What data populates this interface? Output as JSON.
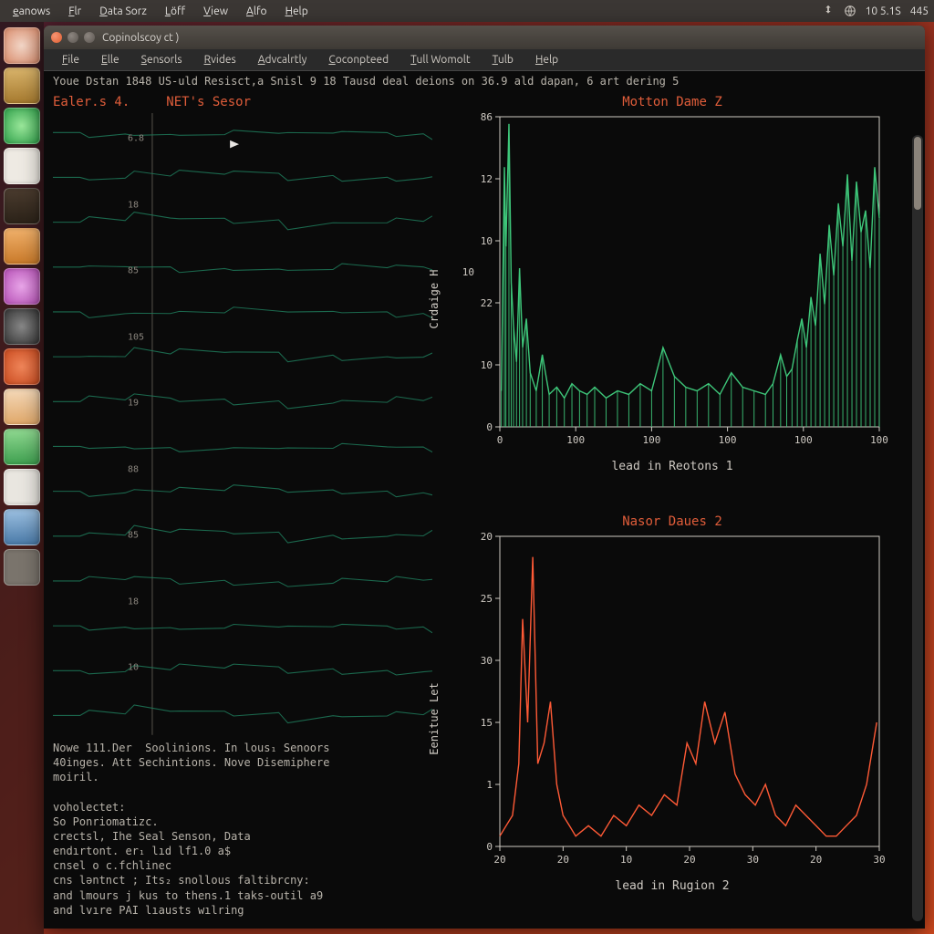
{
  "os_menubar": {
    "items": [
      "eanows",
      "Flr",
      "Data Sorz",
      "Löff",
      "View",
      "Alfo",
      "Help"
    ],
    "tray": {
      "time": "10 5.1S",
      "extra": "445"
    }
  },
  "launcher": {
    "apps": [
      "app-1",
      "app-2",
      "app-3",
      "app-4",
      "app-5",
      "app-6",
      "app-7",
      "app-8",
      "app-9",
      "app-10",
      "app-11",
      "app-12",
      "app-13",
      "app-14"
    ]
  },
  "window": {
    "title": "Copinolscoy ct )",
    "menubar": [
      "File",
      "Elle",
      "Sensorls",
      "Rvides",
      "Advcalrtly",
      "Coconpteed",
      "Tull Womolt",
      "Tulb",
      "Help"
    ],
    "status_line": "Youe Dstan 1848           US-uld Resisct,a  Snisl 9 18  Tausd deal deions on 36.9 ald dapan, 6 art dering 5"
  },
  "left_panel": {
    "title_a": "Ealer.s 4.",
    "title_b": "NET's Sesor",
    "yticks": [
      "6.8",
      "18",
      "85",
      "105",
      "19",
      "88",
      "85",
      "18",
      "10"
    ],
    "terminal_lines": [
      "Nowe 111.Der  Soolinions. In lous₁ Senoors",
      "40inges. Att Sechintions. Nove Disemiphere",
      "moiril.",
      "",
      "voholectet:",
      "So Ponriomatizc.",
      "crectsl, Ihe Seal Senson, Data",
      "endırtont. er₁ lıd lf1.0 a$",
      "cnsel o c.fchlinec",
      "cns lәntnct ; Its₂ snollous faltibrcny:",
      "and lmours j kus to thens.1 taks-outil a9",
      "and lvıre PAI lıausts wılring"
    ]
  },
  "chart_data": [
    {
      "type": "line",
      "title": "Motton Dame Z",
      "xlabel": "lead in Reotons 1",
      "ylabel": "Crdaige H",
      "xlim": [
        0,
        500
      ],
      "ylim": [
        0,
        86
      ],
      "xticks": [
        0,
        100,
        100,
        100,
        100,
        100
      ],
      "yticks": [
        0,
        10,
        22,
        10,
        12,
        86
      ],
      "y_outer_tick": 10,
      "color": "#3ec77a",
      "x": [
        2,
        6,
        8,
        12,
        15,
        18,
        22,
        26,
        30,
        35,
        40,
        48,
        56,
        65,
        75,
        85,
        95,
        105,
        115,
        125,
        140,
        155,
        170,
        185,
        200,
        215,
        230,
        245,
        260,
        275,
        290,
        305,
        320,
        335,
        350,
        360,
        370,
        378,
        385,
        392,
        398,
        404,
        410,
        416,
        422,
        428,
        434,
        440,
        446,
        452,
        458,
        464,
        470,
        476,
        482,
        488,
        494,
        500
      ],
      "y": [
        10,
        72,
        50,
        84,
        40,
        28,
        18,
        44,
        22,
        30,
        15,
        10,
        20,
        9,
        11,
        8,
        12,
        10,
        9,
        11,
        8,
        10,
        9,
        12,
        10,
        22,
        14,
        11,
        10,
        12,
        9,
        15,
        11,
        10,
        9,
        12,
        20,
        14,
        16,
        24,
        30,
        22,
        36,
        28,
        48,
        34,
        56,
        42,
        62,
        50,
        70,
        46,
        68,
        54,
        60,
        44,
        72,
        58
      ]
    },
    {
      "type": "line",
      "title": "Nasor Daues 2",
      "xlabel": "lead in Rugion 2",
      "ylabel": "Eenitue Let",
      "xlim": [
        0,
        300
      ],
      "ylim": [
        0,
        30
      ],
      "xticks": [
        20,
        20,
        10,
        20,
        30,
        20,
        30
      ],
      "yticks": [
        0,
        1,
        15,
        30,
        25,
        20
      ],
      "color": "#ff5a36",
      "x": [
        0,
        5,
        10,
        15,
        18,
        22,
        26,
        30,
        35,
        40,
        45,
        50,
        55,
        60,
        70,
        80,
        90,
        100,
        110,
        120,
        130,
        140,
        148,
        155,
        162,
        170,
        178,
        186,
        194,
        202,
        210,
        218,
        226,
        234,
        242,
        250,
        258,
        266,
        274,
        282,
        290,
        298
      ],
      "y": [
        1,
        2,
        3,
        8,
        22,
        12,
        28,
        8,
        10,
        14,
        6,
        3,
        2,
        1,
        2,
        1,
        3,
        2,
        4,
        3,
        5,
        4,
        10,
        8,
        14,
        10,
        13,
        7,
        5,
        4,
        6,
        3,
        2,
        4,
        3,
        2,
        1,
        1,
        2,
        3,
        6,
        12
      ]
    }
  ]
}
